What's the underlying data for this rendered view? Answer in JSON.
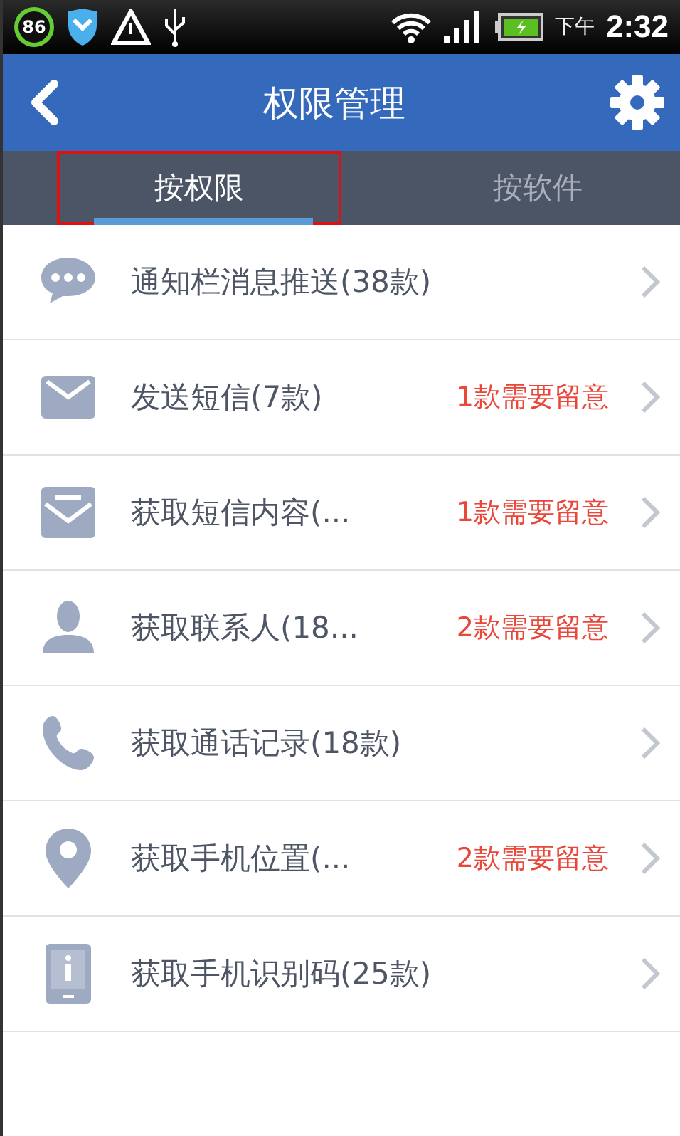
{
  "status_bar": {
    "badge": "86",
    "period": "下午",
    "time": "2:32"
  },
  "header": {
    "title": "权限管理"
  },
  "tabs": [
    {
      "label": "按权限",
      "selected": true,
      "outlined": true
    },
    {
      "label": "按软件",
      "selected": false,
      "outlined": false
    }
  ],
  "rows": [
    {
      "name": "通知栏消息推送(38款)"
    },
    {
      "name": "发送短信(7款)",
      "note": "1款需要留意"
    },
    {
      "name": "获取短信内容(...",
      "note": "1款需要留意"
    },
    {
      "name": "获取联系人(18...",
      "note": "2款需要留意"
    },
    {
      "name": "获取通话记录(18款)"
    },
    {
      "name": "获取手机位置(...",
      "note": "2款需要留意"
    },
    {
      "name": "获取手机识别码(25款)"
    }
  ]
}
